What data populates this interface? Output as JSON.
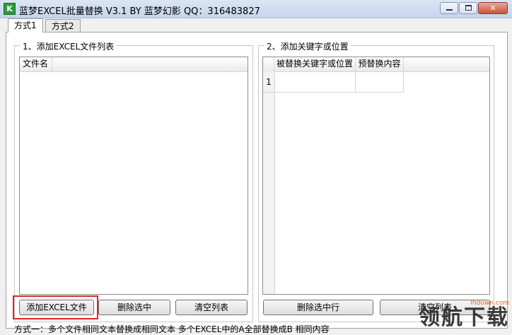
{
  "window": {
    "icon_letter": "K",
    "title": "蓝梦EXCEL批量替换 V3.1 BY 蓝梦幻影 QQ：316483827",
    "controls": {
      "close_label": "✕"
    }
  },
  "tabs": [
    {
      "label": "方式1",
      "active": true
    },
    {
      "label": "方式2",
      "active": false
    }
  ],
  "left_group": {
    "title": "1、添加EXCEL文件列表",
    "columns": [
      "文件名"
    ],
    "buttons": {
      "add": "添加EXCEL文件",
      "delete_selected": "删除选中",
      "clear_list": "清空列表"
    }
  },
  "right_group": {
    "title": "2、添加关键字或位置",
    "columns": [
      "被替换关键字或位置",
      "预替换内容"
    ],
    "rows": [
      {
        "index": "1",
        "keyword": "",
        "replacement": ""
      }
    ],
    "buttons": {
      "delete_row": "删除选中行",
      "clear_list": "清空列表"
    }
  },
  "status": "方式一：多个文件相同文本替换成相同文本  多个EXCEL中的A全部替换成B 相同内容",
  "watermark": {
    "url": "lhdown.com",
    "text": "领航下载"
  },
  "colors": {
    "highlight": "#e0242b",
    "titlebar": "#c4d5ec"
  }
}
